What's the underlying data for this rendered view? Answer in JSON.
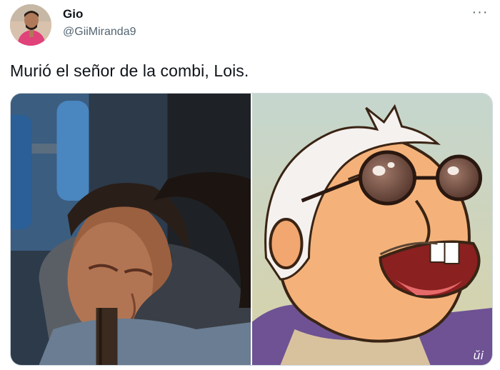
{
  "author": {
    "display_name": "Gio",
    "handle": "@GiiMiranda9",
    "avatar_icon": "user-avatar-photo"
  },
  "menu": {
    "more_icon": "more-horizontal-icon",
    "more_glyph": "···"
  },
  "tweet": {
    "text": "Murió el señor de la combi, Lois."
  },
  "media": {
    "count": 2,
    "images": [
      {
        "semantic": "photo-man-crying-hug"
      },
      {
        "semantic": "cartoon-old-man-sunglasses-laughing"
      }
    ],
    "watermark": "ŭi"
  },
  "colors": {
    "text_primary": "#0f1419",
    "text_secondary": "#536471",
    "border": "#cfd9de"
  }
}
